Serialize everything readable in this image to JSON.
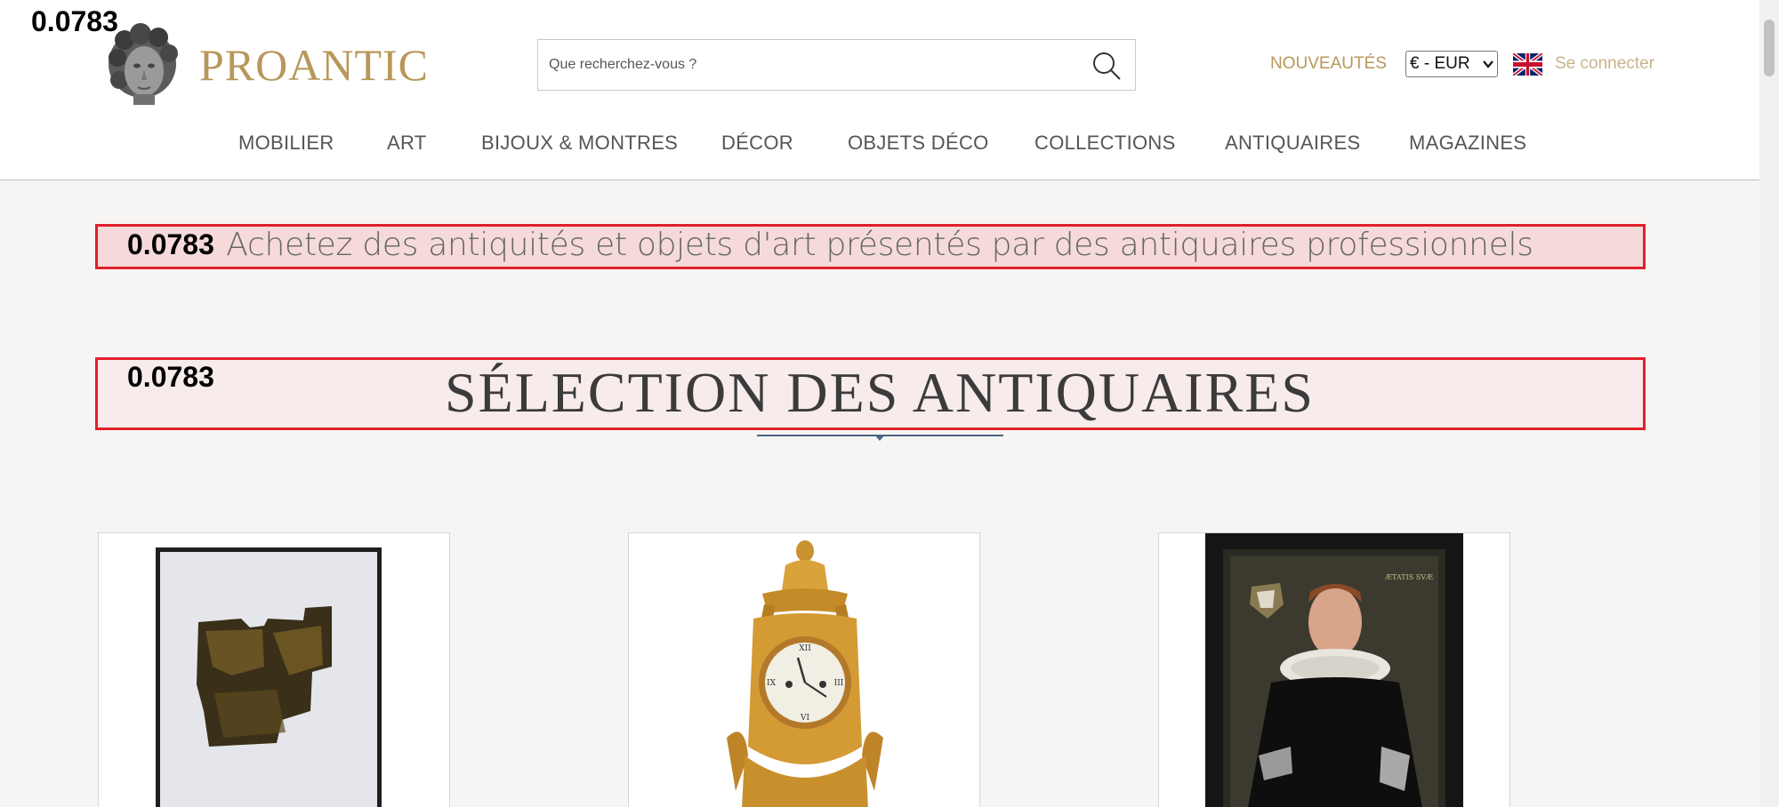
{
  "debug_scores": [
    "0.0783",
    "0.0783",
    "0.0783"
  ],
  "header": {
    "brand": "PROANTIC",
    "search_placeholder": "Que recherchez-vous ?",
    "nouveautes": "NOUVEAUTÉS",
    "currency": "€ - EUR",
    "login": "Se connecter"
  },
  "nav": [
    "MOBILIER",
    "ART",
    "BIJOUX & MONTRES",
    "DÉCOR",
    "OBJETS DÉCO",
    "COLLECTIONS",
    "ANTIQUAIRES",
    "MAGAZINES"
  ],
  "tagline": "Achetez des antiquités et objets d'art présentés par des antiquaires professionnels",
  "section_title": "SÉLECTION DES ANTIQUAIRES",
  "colors": {
    "brand_gold": "#b8975a",
    "highlight_red": "#e0202a",
    "rule_blue": "#4a6484"
  },
  "products": [
    {
      "icon": "abstract-painting-image"
    },
    {
      "icon": "gilt-bronze-clock-image"
    },
    {
      "icon": "portrait-painting-image"
    }
  ]
}
